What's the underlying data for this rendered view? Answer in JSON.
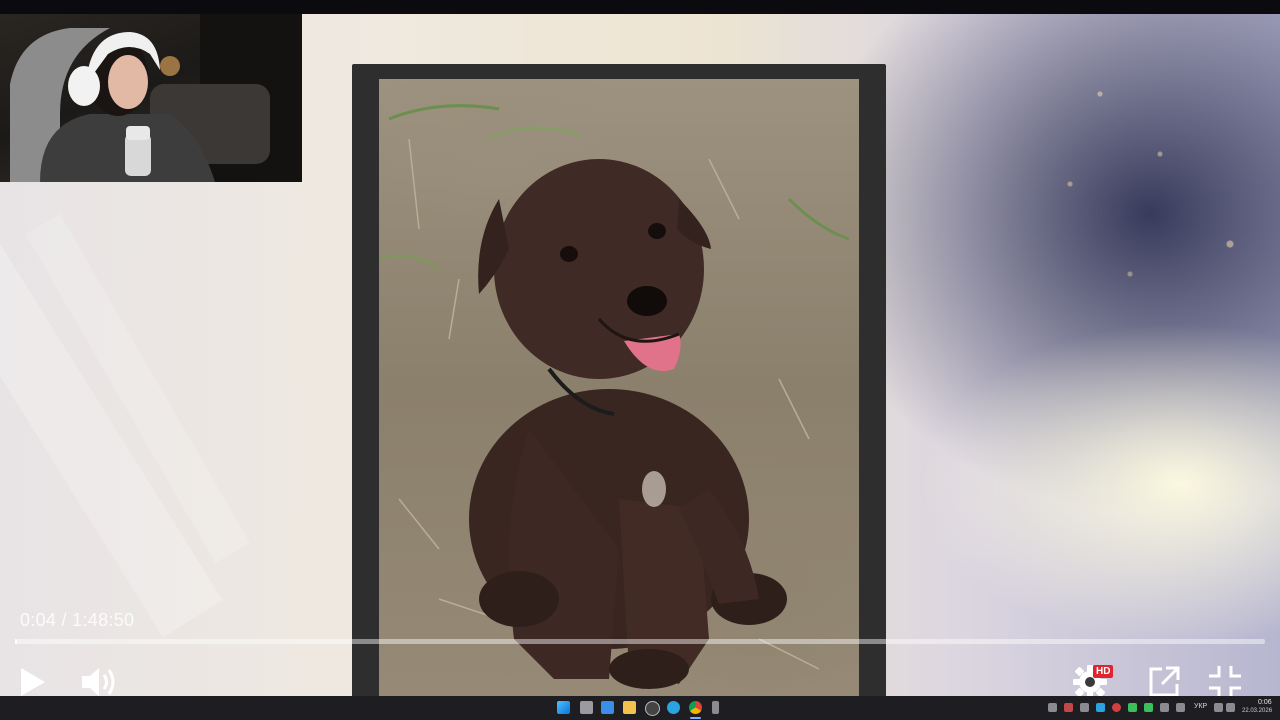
{
  "player": {
    "current_time": "0:04",
    "separator": "/",
    "duration": "1:48:50",
    "progress_fraction": 0.0006,
    "quality_badge": "HD"
  },
  "taskbar": {
    "language": "УКР",
    "clock_time": "0:06",
    "clock_date": "22.03.2026"
  },
  "colors": {
    "hd_badge": "#e0232e",
    "taskbar_bg": "#1d1d22",
    "frame": "#2e2e2e"
  }
}
